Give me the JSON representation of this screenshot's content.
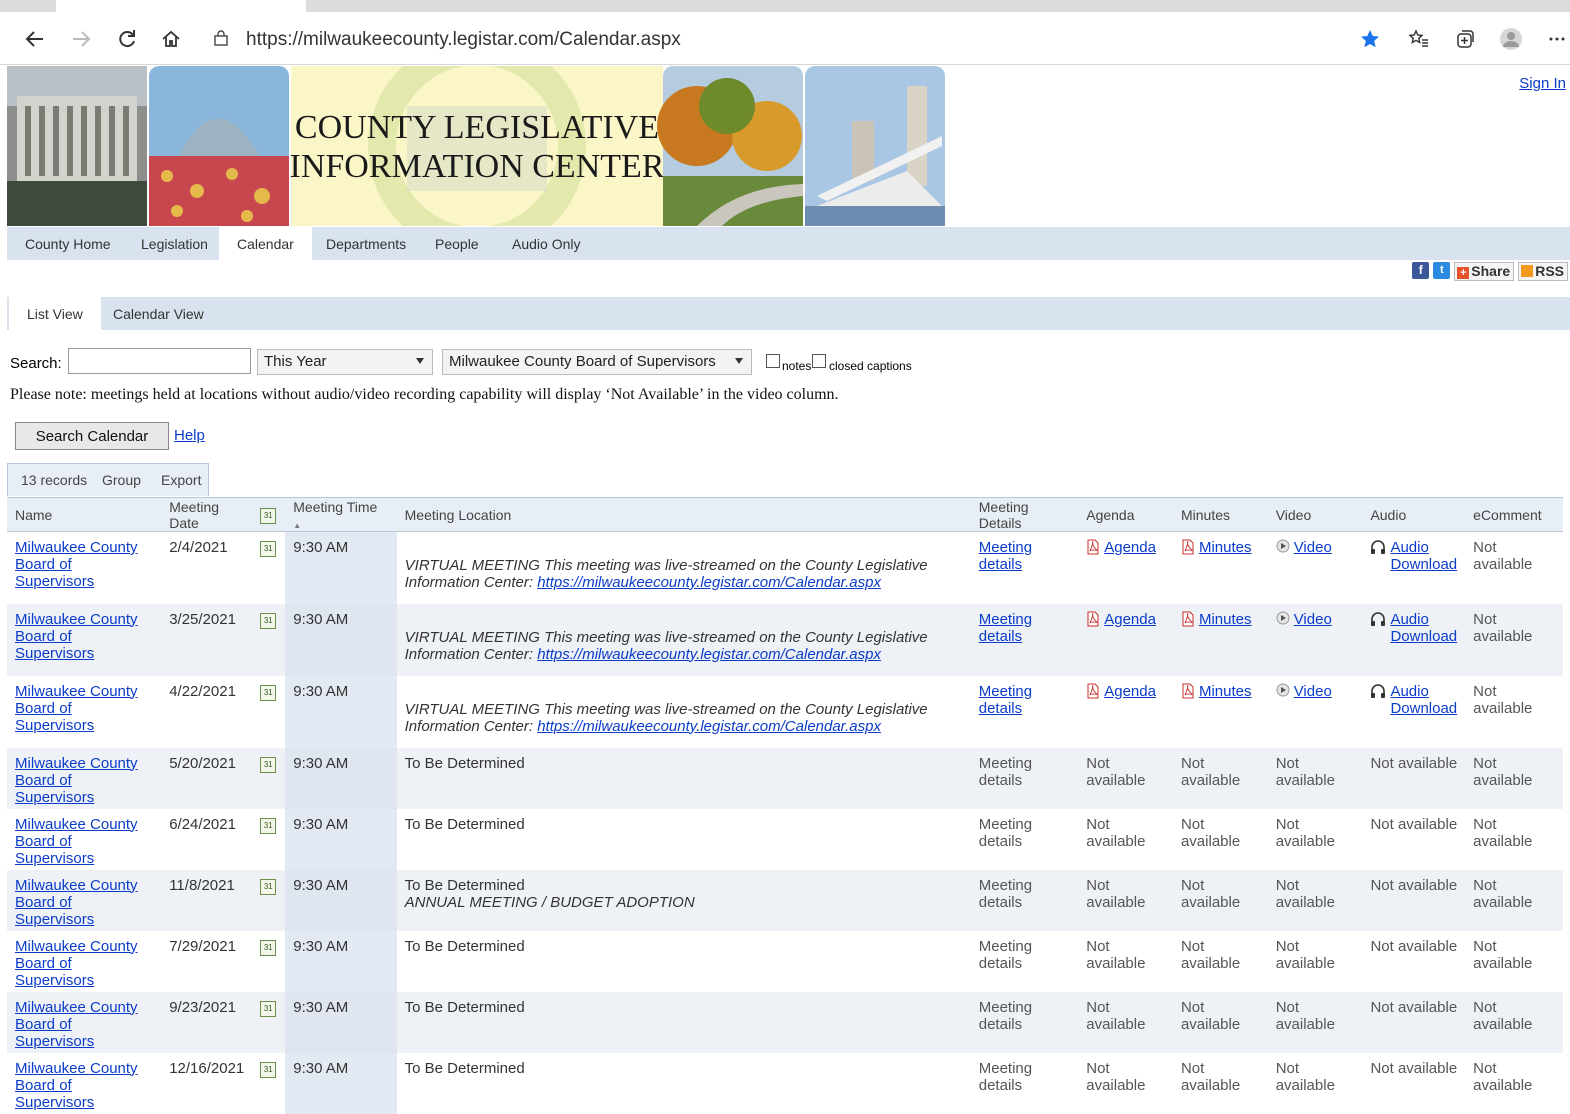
{
  "browser": {
    "url": "https://milwaukeecounty.legistar.com/Calendar.aspx"
  },
  "header": {
    "banner_title_line1": "COUNTY LEGISLATIVE",
    "banner_title_line2": "INFORMATION CENTER",
    "sign_in": "Sign In"
  },
  "nav": {
    "items": [
      {
        "label": "County Home"
      },
      {
        "label": "Legislation"
      },
      {
        "label": "Calendar"
      },
      {
        "label": "Departments"
      },
      {
        "label": "People"
      },
      {
        "label": "Audio Only"
      }
    ],
    "active": "Calendar"
  },
  "social": {
    "share": "Share",
    "rss": "RSS"
  },
  "views": {
    "list": "List View",
    "calendar": "Calendar View"
  },
  "search": {
    "label": "Search:",
    "value": "",
    "year_select": "This Year",
    "body_select": "Milwaukee County Board of Supervisors",
    "notes": "notes",
    "captions": "closed captions"
  },
  "note": "Please note: meetings held at locations without audio/video recording capability will display ‘Not Available’ in the video column.",
  "buttons": {
    "search": "Search Calendar",
    "help": "Help"
  },
  "gridtools": {
    "records": "13 records",
    "group": "Group",
    "export": "Export"
  },
  "columns": [
    "Name",
    "Meeting Date",
    "",
    "Meeting Time",
    "Meeting Location",
    "Meeting Details",
    "Agenda",
    "Minutes",
    "Video",
    "Audio",
    "eComment"
  ],
  "rows": [
    {
      "name1": "Milwaukee County",
      "name2": "Board of Supervisors",
      "date": "2/4/2021",
      "time": "9:30 AM",
      "location": "",
      "loc_note": "VIRTUAL MEETING This meeting was live-streamed on the County Legislative Information Center: ",
      "loc_link": "https://milwaukeecounty.legistar.com/Calendar.aspx",
      "details": "Meeting details",
      "agenda": "Agenda",
      "minutes": "Minutes",
      "video": "Video",
      "audio1": "Audio",
      "audio2": "Download",
      "ecomment": "Not available",
      "available": true
    },
    {
      "name1": "Milwaukee County",
      "name2": "Board of Supervisors",
      "date": "3/25/2021",
      "time": "9:30 AM",
      "location": "",
      "loc_note": "VIRTUAL MEETING This meeting was live-streamed on the County Legislative Information Center: ",
      "loc_link": "https://milwaukeecounty.legistar.com/Calendar.aspx",
      "details": "Meeting details",
      "agenda": "Agenda",
      "minutes": "Minutes",
      "video": "Video",
      "audio1": "Audio",
      "audio2": "Download",
      "ecomment": "Not available",
      "available": true
    },
    {
      "name1": "Milwaukee County",
      "name2": "Board of Supervisors",
      "date": "4/22/2021",
      "time": "9:30 AM",
      "location": "",
      "loc_note": "VIRTUAL MEETING This meeting was live-streamed on the County Legislative Information Center: ",
      "loc_link": "https://milwaukeecounty.legistar.com/Calendar.aspx",
      "details": "Meeting details",
      "agenda": "Agenda",
      "minutes": "Minutes",
      "video": "Video",
      "audio1": "Audio",
      "audio2": "Download",
      "ecomment": "Not available",
      "available": true
    },
    {
      "name1": "Milwaukee County",
      "name2": "Board of Supervisors",
      "date": "5/20/2021",
      "time": "9:30 AM",
      "location": "To Be Determined",
      "loc_note": "",
      "loc_link": "",
      "details": "Meeting details",
      "agenda": "Not available",
      "minutes": "Not available",
      "video": "Not available",
      "audio1": "Not available",
      "audio2": "",
      "ecomment": "Not available",
      "available": false
    },
    {
      "name1": "Milwaukee County",
      "name2": "Board of Supervisors",
      "date": "6/24/2021",
      "time": "9:30 AM",
      "location": "To Be Determined",
      "loc_note": "",
      "loc_link": "",
      "details": "Meeting details",
      "agenda": "Not available",
      "minutes": "Not available",
      "video": "Not available",
      "audio1": "Not available",
      "audio2": "",
      "ecomment": "Not available",
      "available": false
    },
    {
      "name1": "Milwaukee County",
      "name2": "Board of Supervisors",
      "date": "11/8/2021",
      "time": "9:30 AM",
      "location": "To Be Determined",
      "loc_note": "ANNUAL MEETING / BUDGET ADOPTION",
      "loc_link": "",
      "details": "Meeting details",
      "agenda": "Not available",
      "minutes": "Not available",
      "video": "Not available",
      "audio1": "Not available",
      "audio2": "",
      "ecomment": "Not available",
      "available": false
    },
    {
      "name1": "Milwaukee County",
      "name2": "Board of Supervisors",
      "date": "7/29/2021",
      "time": "9:30 AM",
      "location": "To Be Determined",
      "loc_note": "",
      "loc_link": "",
      "details": "Meeting details",
      "agenda": "Not available",
      "minutes": "Not available",
      "video": "Not available",
      "audio1": "Not available",
      "audio2": "",
      "ecomment": "Not available",
      "available": false
    },
    {
      "name1": "Milwaukee County",
      "name2": "Board of Supervisors",
      "date": "9/23/2021",
      "time": "9:30 AM",
      "location": "To Be Determined",
      "loc_note": "",
      "loc_link": "",
      "details": "Meeting details",
      "agenda": "Not available",
      "minutes": "Not available",
      "video": "Not available",
      "audio1": "Not available",
      "audio2": "",
      "ecomment": "Not available",
      "available": false
    },
    {
      "name1": "Milwaukee County",
      "name2": "Board of Supervisors",
      "date": "12/16/2021",
      "time": "9:30 AM",
      "location": "To Be Determined",
      "loc_note": "",
      "loc_link": "",
      "details": "Meeting details",
      "agenda": "Not available",
      "minutes": "Not available",
      "video": "Not available",
      "audio1": "Not available",
      "audio2": "",
      "ecomment": "Not available",
      "available": false
    }
  ],
  "colors": {
    "link": "#0b3cc9",
    "nav_bg": "#d8e3ef",
    "favorite_star": "#1a73e8"
  }
}
